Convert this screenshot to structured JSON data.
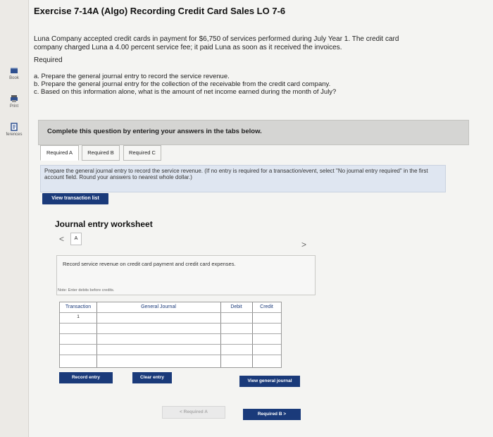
{
  "sidebar": {
    "items": [
      {
        "label": "Book",
        "icon": "book-icon"
      },
      {
        "label": "Print",
        "icon": "print-icon"
      },
      {
        "label": "ferences",
        "icon": "references-icon"
      }
    ]
  },
  "exercise": {
    "title": "Exercise 7-14A (Algo) Recording Credit Card Sales LO 7-6",
    "intro": "Luna Company accepted credit cards in payment for $6,750 of services performed during July Year 1. The credit card company charged Luna a 4.00 percent service fee; it paid Luna as soon as it received the invoices.",
    "required_heading": "Required",
    "requirements": [
      "a. Prepare the general journal entry to record the service revenue.",
      "b. Prepare the general journal entry for the collection of the receivable from the credit card company.",
      "c. Based on this information alone, what is the amount of net income earned during the month of July?"
    ]
  },
  "banner": "Complete this question by entering your answers in the tabs below.",
  "tabs": [
    "Required A",
    "Required B",
    "Required C"
  ],
  "instruction": "Prepare the general journal entry to record the service revenue. (If no entry is required for a transaction/event, select \"No journal entry required\" in the first account field. Round your answers to nearest whole dollar.)",
  "buttons": {
    "view_transaction": "View transaction list",
    "record_entry": "Record entry",
    "clear_entry": "Clear entry",
    "view_general_journal": "View general journal",
    "prev_required": "< Required A",
    "next_required": "Required B  >"
  },
  "worksheet": {
    "title": "Journal entry worksheet",
    "step": "A",
    "description": "Record service revenue on credit card payment and credit card expenses.",
    "note": "Note: Enter debits before credits.",
    "headers": [
      "Transaction",
      "General Journal",
      "Debit",
      "Credit"
    ],
    "rows": [
      [
        "1",
        "",
        "",
        ""
      ],
      [
        "",
        "",
        "",
        ""
      ],
      [
        "",
        "",
        "",
        ""
      ],
      [
        "",
        "",
        "",
        ""
      ],
      [
        "",
        "",
        "",
        ""
      ]
    ]
  }
}
